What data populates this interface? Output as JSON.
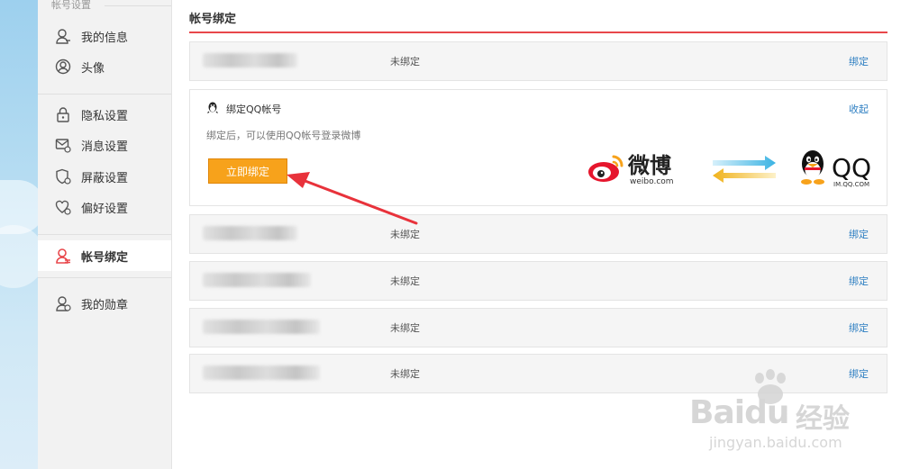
{
  "sidebar": {
    "section_title": "帐号设置",
    "items": [
      {
        "label": "我的信息",
        "icon": "user-icon"
      },
      {
        "label": "头像",
        "icon": "avatar-icon"
      },
      {
        "label": "隐私设置",
        "icon": "lock-icon"
      },
      {
        "label": "消息设置",
        "icon": "message-settings-icon"
      },
      {
        "label": "屏蔽设置",
        "icon": "shield-block-icon"
      },
      {
        "label": "偏好设置",
        "icon": "heart-settings-icon"
      },
      {
        "label": "帐号绑定",
        "icon": "account-bind-icon",
        "active": true
      },
      {
        "label": "我的勋章",
        "icon": "medal-user-icon"
      }
    ]
  },
  "main": {
    "title": "帐号绑定",
    "accent_color": "#e8474b",
    "rows_top": [
      {
        "status": "未绑定",
        "action": "绑定"
      }
    ],
    "qq_panel": {
      "title": "绑定QQ帐号",
      "collapse": "收起",
      "description": "绑定后，可以使用QQ帐号登录微博",
      "button": "立即绑定",
      "button_color": "#f7a21b",
      "weibo_logo_cn": "微博",
      "weibo_logo_en": "weibo.com",
      "qq_logo_text": "QQ",
      "qq_logo_url": "IM.QQ.COM"
    },
    "rows_bottom": [
      {
        "status": "未绑定",
        "action": "绑定"
      },
      {
        "status": "未绑定",
        "action": "绑定"
      },
      {
        "status": "未绑定",
        "action": "绑定"
      },
      {
        "status": "未绑定",
        "action": "绑定"
      }
    ]
  },
  "watermark": {
    "brand": "Bai",
    "brand_tail": "du",
    "product": "经验",
    "url": "jingyan.baidu.com"
  }
}
